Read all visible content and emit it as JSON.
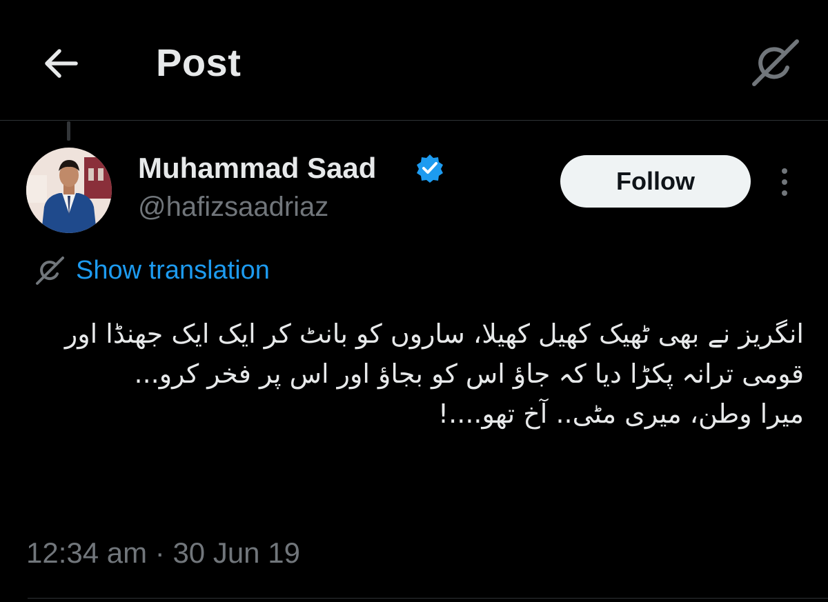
{
  "header": {
    "title": "Post",
    "back_icon": "arrow-left-icon",
    "grok_icon": "grok-icon"
  },
  "author": {
    "display_name": "Muhammad Saad",
    "handle": "@hafizsaadriaz",
    "verified": true,
    "verified_color": "#1d9bf0"
  },
  "actions": {
    "follow_label": "Follow",
    "more_icon": "more-vertical-icon"
  },
  "translation": {
    "label": "Show translation",
    "icon": "grok-translate-icon",
    "color": "#1d9bf0"
  },
  "post": {
    "text": "انگریز نے بھی ٹھیک کھیل کھیلا، ساروں کو بانٹ کر ایک ایک جھنڈا اور قومی ترانہ پکڑا دیا کہ جاؤ اس کو بجاؤ اور اس پر فخر کرو...\nمیرا وطن، میری مٹی.. آخ تھو....!",
    "timestamp": "12:34 am · 30 Jun 19"
  },
  "colors": {
    "background": "#000000",
    "text_primary": "#e7e9ea",
    "text_secondary": "#71767b",
    "accent": "#1d9bf0",
    "divider": "#2f3336"
  }
}
